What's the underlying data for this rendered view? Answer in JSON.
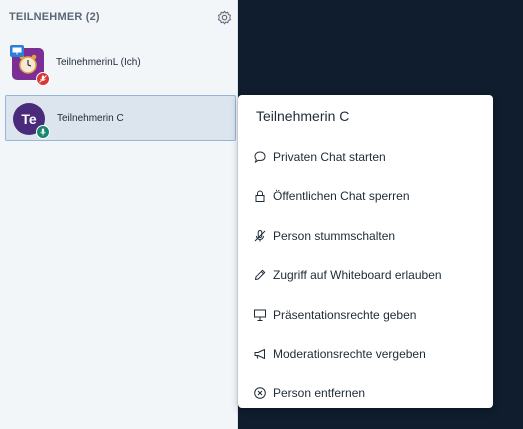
{
  "sidebar": {
    "header": "TEILNEHMER (2)",
    "users": [
      {
        "name": "TeilnehmerinL (Ich)",
        "avatar_color": "#7b2e96",
        "status_color": "#d93636"
      },
      {
        "name": "Teilnehmerin C",
        "initials": "Te",
        "avatar_color": "#4a2a7a",
        "status_color": "#18866d"
      }
    ]
  },
  "menu": {
    "title": "Teilnehmerin C",
    "items": [
      {
        "label": "Privaten Chat starten",
        "icon": "chat-bubble-icon"
      },
      {
        "label": "Öffentlichen Chat sperren",
        "icon": "lock-icon"
      },
      {
        "label": "Person stummschalten",
        "icon": "microphone-muted-icon"
      },
      {
        "label": "Zugriff auf Whiteboard erlauben",
        "icon": "pencil-icon"
      },
      {
        "label": "Präsentationsrechte geben",
        "icon": "presentation-icon"
      },
      {
        "label": "Moderationsrechte vergeben",
        "icon": "megaphone-icon"
      },
      {
        "label": "Person entfernen",
        "icon": "remove-circle-icon"
      }
    ]
  },
  "colors": {
    "dark_panel": "#0f1d2e",
    "selection_border": "#95b5da",
    "presenter_badge": "#2a7fd6"
  }
}
